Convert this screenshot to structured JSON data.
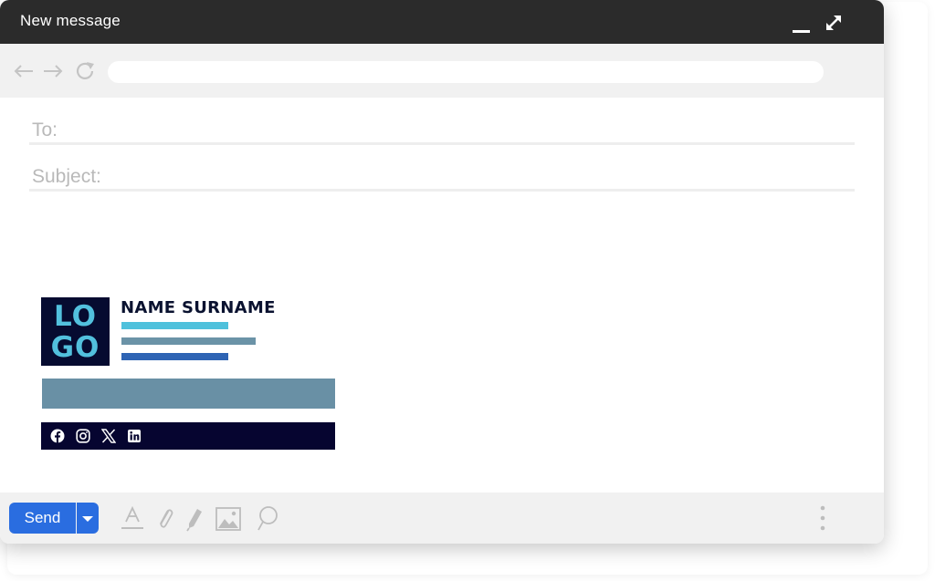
{
  "window": {
    "title": "New message"
  },
  "navigation": {
    "back_icon": "arrow-left-icon",
    "forward_icon": "arrow-right-icon",
    "reload_icon": "reload-icon",
    "url": ""
  },
  "compose": {
    "to_label": "To:",
    "to_value": "",
    "subject_label": "Subject:",
    "subject_value": ""
  },
  "signature": {
    "logo_line1": "LO",
    "logo_line2": "GO",
    "name": "NAME SURNAME",
    "colors": {
      "logo_bg": "#060b30",
      "logo_text": "#52c0dd",
      "line1": "#4fc1dc",
      "line2": "#6b93a7",
      "line3": "#2e64b4",
      "banner": "#6990a5",
      "social_bar": "#060530"
    },
    "social_icons": [
      "facebook-icon",
      "instagram-icon",
      "x-icon",
      "linkedin-icon"
    ]
  },
  "toolbar": {
    "send_label": "Send",
    "send_color": "#2a6de0",
    "tools": [
      "text-format-icon",
      "attach-icon",
      "pen-icon",
      "image-icon",
      "emoji-icon"
    ],
    "more_icon": "more-vertical-icon"
  }
}
